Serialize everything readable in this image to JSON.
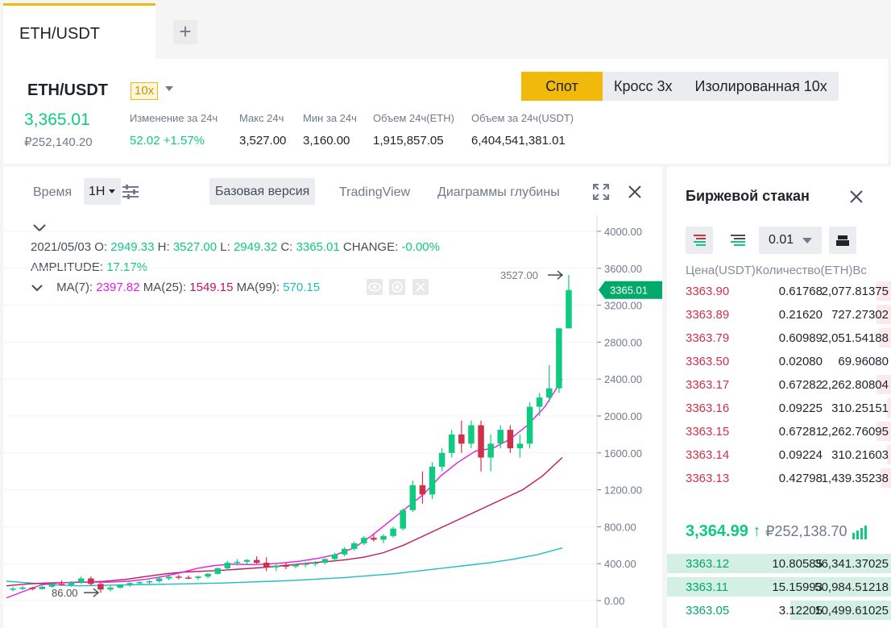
{
  "tabs": {
    "active": "ETH/USDT",
    "add": "+"
  },
  "header": {
    "pair": "ETH/USDT",
    "leverage": "10x",
    "price": "3,365.01",
    "price_rub": "₽252,140.20",
    "stats": [
      {
        "label": "Изменение за 24ч",
        "value": "52.02 +1.57%",
        "green": true
      },
      {
        "label": "Макс 24ч",
        "value": "3,527.00"
      },
      {
        "label": "Мин за 24ч",
        "value": "3,160.00"
      },
      {
        "label": "Объем 24ч(ETH)",
        "value": "1,915,857.05"
      },
      {
        "label": "Объем за 24ч(USDT)",
        "value": "6,404,541,381.01"
      }
    ],
    "modes": [
      "Спот",
      "Кросс 3x",
      "Изолированная 10x"
    ]
  },
  "toolbar": {
    "time_label": "Время",
    "interval": "1H",
    "base": "Базовая версия",
    "tradingview": "TradingView",
    "depth": "Диаграммы глубины"
  },
  "legend": {
    "date": "2021/05/03",
    "o_label": "O:",
    "o": "2949.33",
    "h_label": "H:",
    "h": "3527.00",
    "l_label": "L:",
    "l": "2949.32",
    "c_label": "C:",
    "c": "3365.01",
    "change_label": "CHANGE:",
    "change": "-0.00%",
    "amp_label": "AMPLITUDE:",
    "amp": "17.17%",
    "ma7_label": "MA(7):",
    "ma7": "2397.82",
    "ma25_label": "MA(25):",
    "ma25": "1549.15",
    "ma99_label": "MA(99):",
    "ma99": "570.15",
    "ma_colors": {
      "ma7": "#e81ce3",
      "ma25": "#c2185b",
      "ma99": "#1ebdc4"
    }
  },
  "chart_data": {
    "type": "candlestick",
    "y_ticks": [
      "4000.00",
      "3600.00",
      "3200.00",
      "2800.00",
      "2400.00",
      "2000.00",
      "1600.00",
      "1200.00",
      "800.00",
      "400.00",
      "0.00"
    ],
    "ylim": [
      0,
      4000
    ],
    "last_price_label": "3365.01",
    "high_marker": "3527.00",
    "low_marker": "86.00",
    "up_color": "#0ecb81",
    "down_color": "#cf304a",
    "candles": [
      [
        120,
        150,
        100,
        130
      ],
      [
        130,
        160,
        115,
        140
      ],
      [
        140,
        150,
        110,
        125
      ],
      [
        125,
        160,
        120,
        150
      ],
      [
        150,
        190,
        140,
        180
      ],
      [
        180,
        220,
        160,
        170
      ],
      [
        170,
        210,
        150,
        200
      ],
      [
        200,
        260,
        180,
        240
      ],
      [
        240,
        260,
        160,
        180
      ],
      [
        180,
        210,
        86,
        120
      ],
      [
        120,
        160,
        100,
        140
      ],
      [
        140,
        180,
        130,
        170
      ],
      [
        170,
        200,
        150,
        190
      ],
      [
        190,
        210,
        170,
        200
      ],
      [
        200,
        220,
        180,
        210
      ],
      [
        210,
        250,
        195,
        240
      ],
      [
        240,
        270,
        220,
        260
      ],
      [
        260,
        280,
        230,
        250
      ],
      [
        250,
        270,
        230,
        245
      ],
      [
        245,
        270,
        225,
        260
      ],
      [
        260,
        300,
        240,
        290
      ],
      [
        290,
        360,
        280,
        350
      ],
      [
        350,
        430,
        330,
        410
      ],
      [
        410,
        450,
        380,
        420
      ],
      [
        420,
        450,
        390,
        440
      ],
      [
        440,
        480,
        400,
        410
      ],
      [
        410,
        470,
        320,
        360
      ],
      [
        360,
        400,
        320,
        380
      ],
      [
        380,
        410,
        340,
        370
      ],
      [
        370,
        400,
        350,
        390
      ],
      [
        390,
        420,
        360,
        400
      ],
      [
        400,
        430,
        370,
        410
      ],
      [
        410,
        460,
        390,
        450
      ],
      [
        450,
        520,
        420,
        500
      ],
      [
        500,
        580,
        480,
        560
      ],
      [
        560,
        640,
        540,
        620
      ],
      [
        620,
        700,
        600,
        680
      ],
      [
        680,
        720,
        640,
        660
      ],
      [
        660,
        720,
        620,
        700
      ],
      [
        700,
        800,
        680,
        780
      ],
      [
        780,
        1000,
        760,
        980
      ],
      [
        980,
        1300,
        960,
        1250
      ],
      [
        1250,
        1400,
        1050,
        1150
      ],
      [
        1150,
        1500,
        1100,
        1450
      ],
      [
        1450,
        1650,
        1400,
        1600
      ],
      [
        1600,
        1850,
        1550,
        1800
      ],
      [
        1800,
        1950,
        1600,
        1700
      ],
      [
        1700,
        1950,
        1650,
        1900
      ],
      [
        1900,
        1950,
        1400,
        1550
      ],
      [
        1550,
        1800,
        1400,
        1700
      ],
      [
        1700,
        1900,
        1650,
        1850
      ],
      [
        1850,
        1900,
        1600,
        1650
      ],
      [
        1650,
        1800,
        1550,
        1700
      ],
      [
        1700,
        2150,
        1650,
        2100
      ],
      [
        2100,
        2250,
        2000,
        2200
      ],
      [
        2200,
        2550,
        2150,
        2300
      ],
      [
        2300,
        2950,
        2250,
        2950
      ],
      [
        2949.33,
        3527,
        2949.32,
        3365.01
      ]
    ],
    "ma7": [
      30,
      100,
      170,
      190,
      200,
      200,
      200,
      210,
      230,
      260,
      300,
      350,
      380,
      395,
      390,
      395,
      410,
      430,
      460,
      500,
      570,
      700,
      850,
      1000,
      1150,
      1350,
      1500,
      1620,
      1650,
      1750,
      1900,
      2100,
      2400
    ],
    "ma25": [
      160,
      180,
      190,
      195,
      200,
      210,
      230,
      260,
      290,
      310,
      320,
      330,
      345,
      360,
      380,
      400,
      420,
      440,
      470,
      520,
      600,
      700,
      800,
      900,
      1000,
      1100,
      1200,
      1350,
      1550
    ],
    "ma99": [
      210,
      190,
      170,
      160,
      165,
      170,
      175,
      180,
      185,
      190,
      200,
      210,
      220,
      235,
      250,
      270,
      290,
      320,
      350,
      380,
      410,
      450,
      500,
      570
    ]
  },
  "orderbook": {
    "title": "Биржевой стакан",
    "step": "0.01",
    "headers": "Цена(USDT)Количество(ETH)Вс",
    "asks": [
      {
        "price": "3363.90",
        "qty": "0.61768",
        "total": "2,077.81375",
        "depth": 0.07
      },
      {
        "price": "3363.89",
        "qty": "0.21620",
        "total": "727.27302",
        "depth": 0.07
      },
      {
        "price": "3363.79",
        "qty": "0.60989",
        "total": "2,051.54188",
        "depth": 0.06
      },
      {
        "price": "3363.50",
        "qty": "0.02080",
        "total": "69.96080",
        "depth": 0.0
      },
      {
        "price": "3363.17",
        "qty": "0.67282",
        "total": "2,262.80804",
        "depth": 0.07
      },
      {
        "price": "3363.16",
        "qty": "0.09225",
        "total": "310.25151",
        "depth": 0.02
      },
      {
        "price": "3363.15",
        "qty": "0.67281",
        "total": "2,262.76095",
        "depth": 0.07
      },
      {
        "price": "3363.14",
        "qty": "0.09224",
        "total": "310.21603",
        "depth": 0.02
      },
      {
        "price": "3363.13",
        "qty": "0.42798",
        "total": "1,439.35238",
        "depth": 0.05
      }
    ],
    "mid_price": "3,364.99",
    "mid_arrow": "↑",
    "mid_rub": "₽252,138.70",
    "bids": [
      {
        "price": "3363.12",
        "qty": "10.80585",
        "total": "36,341.37025",
        "depth": 1.0
      },
      {
        "price": "3363.11",
        "qty": "15.15993",
        "total": "50,984.51218",
        "depth": 1.0
      },
      {
        "price": "3363.05",
        "qty": "3.12205",
        "total": "10,499.61025",
        "depth": 0.45
      }
    ]
  }
}
